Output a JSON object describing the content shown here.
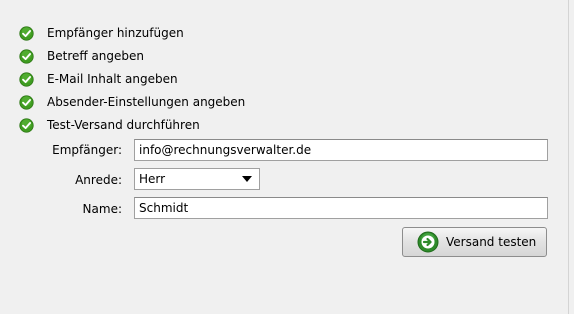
{
  "steps": [
    {
      "label": "Empfänger hinzufügen",
      "icon": "check-icon",
      "status": "done"
    },
    {
      "label": "Betreff angeben",
      "icon": "check-icon",
      "status": "done"
    },
    {
      "label": "E-Mail Inhalt angeben",
      "icon": "check-icon",
      "status": "done"
    },
    {
      "label": "Absender-Einstellungen angeben",
      "icon": "check-icon",
      "status": "done"
    },
    {
      "label": "Test-Versand durchführen",
      "icon": "check-icon",
      "status": "done"
    }
  ],
  "form": {
    "recipient_label": "Empfänger:",
    "recipient_value": "info@rechnungsverwalter.de",
    "salutation_label": "Anrede:",
    "salutation_value": "Herr",
    "name_label": "Name:",
    "name_value": "Schmidt"
  },
  "test_button": {
    "label": "Versand testen",
    "icon": "arrow-right-circle-icon"
  },
  "colors": {
    "check_green": "#3c9a1e",
    "background": "#f0f0f0"
  }
}
